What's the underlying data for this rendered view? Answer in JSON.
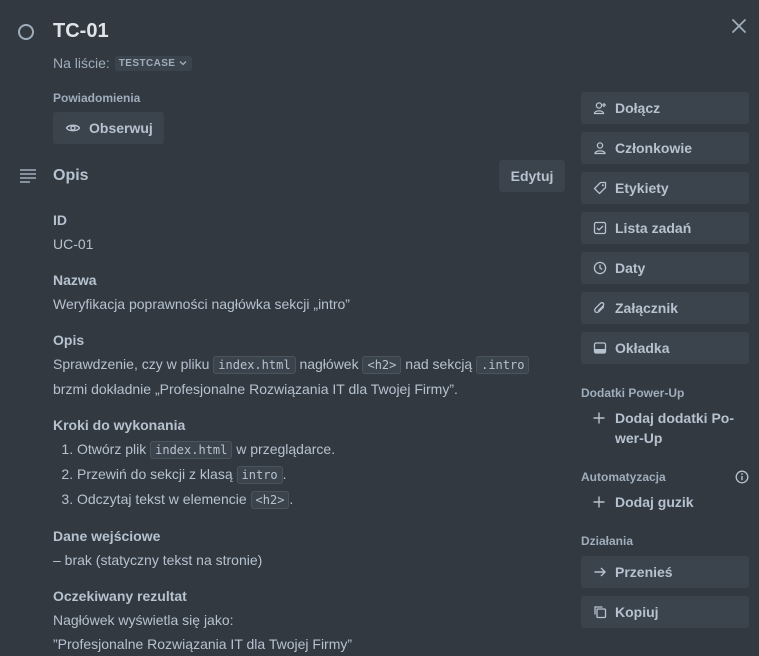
{
  "card": {
    "title": "TC-01",
    "list_prefix": "Na liście:",
    "list_name": "TESTCASE"
  },
  "notifications": {
    "label": "Powiadomienia",
    "watch_label": "Obserwuj"
  },
  "description": {
    "heading": "Opis",
    "edit_label": "Edytuj",
    "sections": {
      "id_heading": "ID",
      "id_value": "UC-01",
      "name_heading": "Nazwa",
      "name_value": "Weryfikacja poprawności nagłówka sekcji „intro”",
      "desc_heading": "Opis",
      "desc_t1": "Sprawdzenie, czy w pliku",
      "desc_c1": "index.html",
      "desc_t2": "nagłówek",
      "desc_c2": "<h2>",
      "desc_t3": "nad sekcją",
      "desc_c3": ".intro",
      "desc_t4": "brzmi dokładnie „Profesjonalne Rozwiązania IT dla Twojej Firmy”.",
      "steps_heading": "Kroki do wykonania",
      "step1_t1": "Otwórz plik",
      "step1_c1": "index.html",
      "step1_t2": "w przeglądarce.",
      "step2_t1": "Przewiń do sekcji z klasą",
      "step2_c1": "intro",
      "step2_t2": ".",
      "step3_t1": "Odczytaj tekst w elemencie",
      "step3_c1": "<h2>",
      "step3_t2": ".",
      "input_heading": "Dane wejściowe",
      "input_value": "– brak (statyczny tekst na stronie)",
      "result_heading": "Oczekiwany rezultat",
      "result_line1": "Nagłówek wyświetla się jako:",
      "result_line2": "”Profesjonalne Rozwiązania IT dla Twojej Firmy”"
    }
  },
  "sidebar": {
    "buttons": [
      {
        "label": "Dołącz",
        "icon": "user-plus-icon"
      },
      {
        "label": "Członkowie",
        "icon": "user-icon"
      },
      {
        "label": "Etykiety",
        "icon": "tag-icon"
      },
      {
        "label": "Lista zadań",
        "icon": "checklist-icon"
      },
      {
        "label": "Daty",
        "icon": "clock-icon"
      },
      {
        "label": "Załącznik",
        "icon": "paperclip-icon"
      },
      {
        "label": "Okładka",
        "icon": "cover-icon"
      }
    ],
    "powerups_label": "Dodatki Power-Up",
    "add_powerups_line1": "Dodaj dodatki Po-",
    "add_powerups_line2": "wer-Up",
    "automation_label": "Automatyzacja",
    "add_button_label": "Dodaj guzik",
    "actions_label": "Działania",
    "move_label": "Przenieś",
    "copy_label": "Kopiuj"
  }
}
